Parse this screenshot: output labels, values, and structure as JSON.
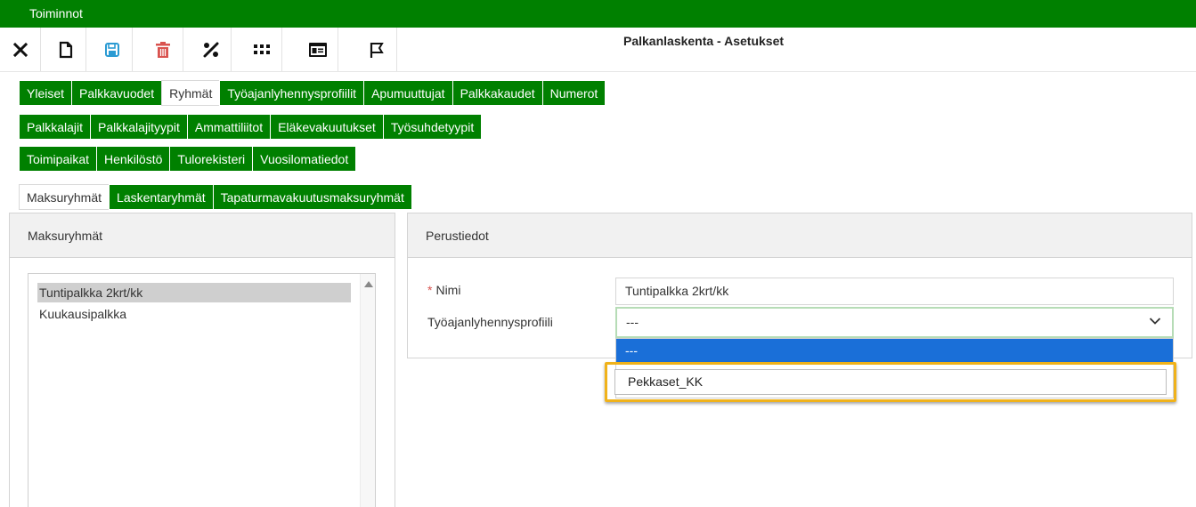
{
  "app": {
    "title": "Toiminnot",
    "page_title": "Palkanlaskenta - Asetukset"
  },
  "toolbar": {
    "icons": [
      "close-icon",
      "new-document-icon",
      "save-icon",
      "delete-icon",
      "percent-icon",
      "grid-icon",
      "card-icon",
      "flag-icon"
    ]
  },
  "tabs": {
    "row1": [
      "Yleiset",
      "Palkkavuodet",
      "Ryhmät",
      "Työajanlyhennysprofiilit",
      "Apumuuttujat",
      "Palkkakaudet",
      "Numerot"
    ],
    "row2": [
      "Palkkalajit",
      "Palkkalajityypit",
      "Ammattiliitot",
      "Eläkevakuutukset",
      "Työsuhdetyypit"
    ],
    "row3": [
      "Toimipaikat",
      "Henkilöstö",
      "Tulorekisteri",
      "Vuosilomatiedot"
    ],
    "subtabs": [
      "Maksuryhmät",
      "Laskentaryhmät",
      "Tapaturmavakuutusmaksuryhmät"
    ],
    "active_row1": "Ryhmät",
    "active_sub": "Maksuryhmät"
  },
  "left_panel": {
    "title": "Maksuryhmät",
    "items": [
      "Tuntipalkka 2krt/kk",
      "Kuukausipalkka"
    ],
    "selected": "Tuntipalkka 2krt/kk"
  },
  "right_panel": {
    "title": "Perustiedot",
    "name_required": "*",
    "name_label": "Nimi",
    "name_value": "Tuntipalkka 2krt/kk",
    "profile_label": "Työajanlyhennysprofiili",
    "profile_value": "---",
    "options": [
      "---",
      "Pekkaset_KK"
    ]
  },
  "colors": {
    "brand_green": "#008000",
    "highlight_blue": "#1a6fd8",
    "focus_orange": "#f0b21a",
    "delete_red": "#d9534f",
    "save_blue": "#2b9bd3"
  }
}
